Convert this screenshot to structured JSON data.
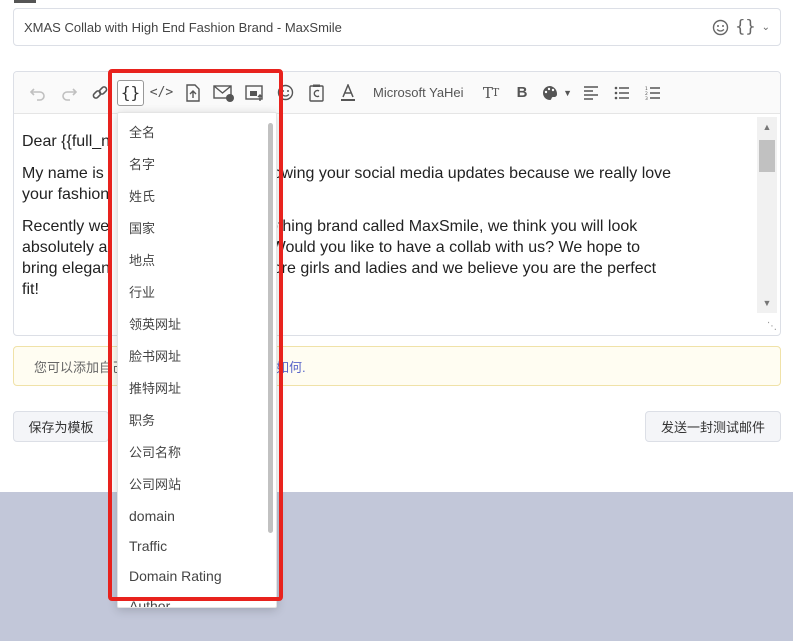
{
  "subject": {
    "value": "XMAS Collab with High End Fashion Brand - MaxSmile",
    "emoji_icon": "smiley-icon",
    "variable_icon": "curly-braces-icon",
    "dropdown_icon": "chevron-down-icon"
  },
  "toolbar": {
    "font_name": "Microsoft YaHei",
    "buttons": [
      "undo-icon",
      "redo-icon",
      "link-icon",
      "variable-icon",
      "code-icon",
      "upload-file-icon",
      "mail-icon",
      "image-icon",
      "emoji-icon",
      "copyright-icon",
      "font-color-icon",
      "font-size-icon",
      "bold-icon",
      "palette-icon",
      "align-left-icon",
      "bullet-list-icon",
      "numbered-list-icon"
    ]
  },
  "body": {
    "greeting": "Dear {{full_n",
    "para1_a": "My name is",
    "para1_b": "n following your social media updates because we really love",
    "para1_c": "your fashion",
    "para2_a": "Recently we",
    "para2_b": "a clothing brand called MaxSmile, we think you will look",
    "para2_c": "absolutely a",
    "para2_d": "igns. Would you like to have a collab with us? We hope to",
    "para2_e": "bring elegan",
    "para2_f": "o more girls and ladies and we believe you are the perfect",
    "para2_g": "fit!"
  },
  "notice": {
    "text": "您可以添加自己",
    "link": "如何."
  },
  "buttons": {
    "save_template": "保存为模板",
    "send_test": "发送一封测试邮件"
  },
  "variables_menu": {
    "items": [
      "全名",
      "名字",
      "姓氏",
      "国家",
      "地点",
      "行业",
      "领英网址",
      "脸书网址",
      "推特网址",
      "职务",
      "公司名称",
      "公司网站"
    ],
    "items_en": [
      "domain",
      "Traffic",
      "Domain Rating",
      "Author"
    ]
  },
  "colors": {
    "highlight": "#e8221d",
    "bottom_band": "#c2c7d9",
    "link": "#5a67c9"
  }
}
